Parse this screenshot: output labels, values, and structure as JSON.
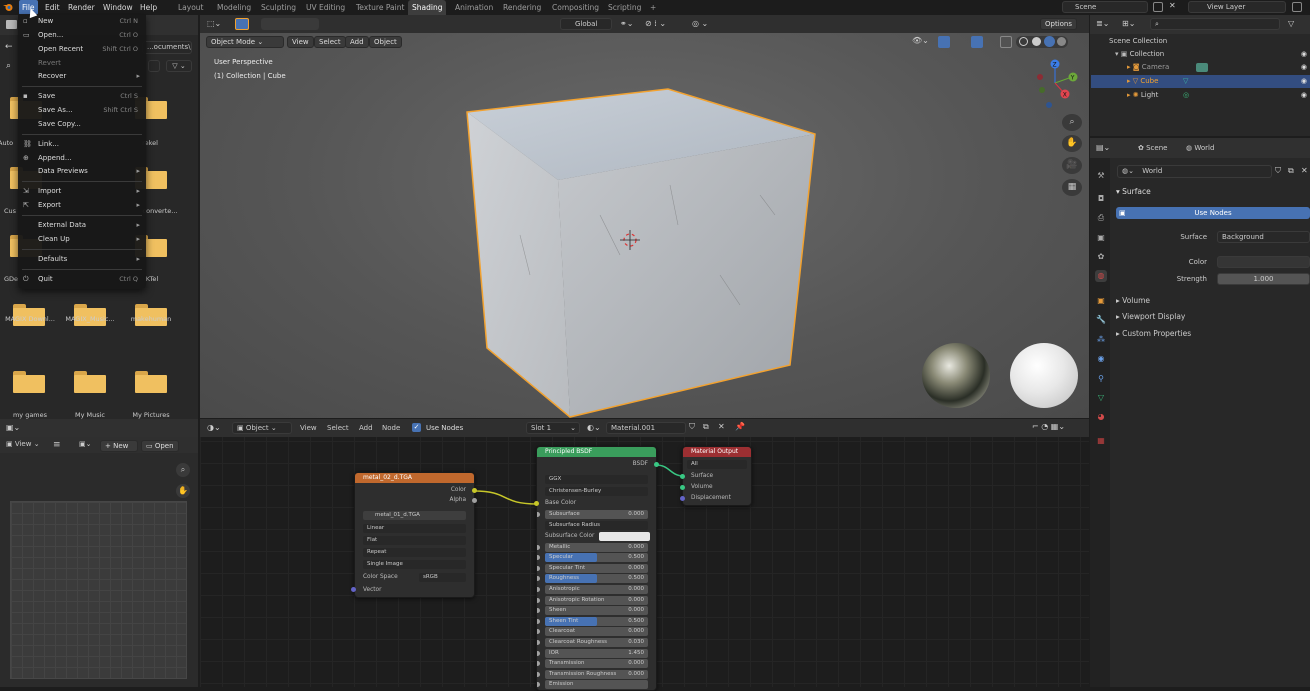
{
  "menubar": {
    "items": [
      "File",
      "Edit",
      "Render",
      "Window",
      "Help"
    ],
    "workspaces": [
      "Layout",
      "Modeling",
      "Sculpting",
      "UV Editing",
      "Texture Paint",
      "Shading",
      "Animation",
      "Rendering",
      "Compositing",
      "Scripting"
    ],
    "add_tab": "+",
    "scene": "Scene",
    "view_layer": "View Layer"
  },
  "file_menu": {
    "new": {
      "label": "New",
      "shortcut": "Ctrl N"
    },
    "open": {
      "label": "Open...",
      "shortcut": "Ctrl O"
    },
    "open_recent": {
      "label": "Open Recent",
      "shortcut": "Shift Ctrl O"
    },
    "revert": {
      "label": "Revert"
    },
    "recover": {
      "label": "Recover"
    },
    "save": {
      "label": "Save",
      "shortcut": "Ctrl S"
    },
    "save_as": {
      "label": "Save As...",
      "shortcut": "Shift Ctrl S"
    },
    "save_copy": {
      "label": "Save Copy..."
    },
    "link": {
      "label": "Link..."
    },
    "append": {
      "label": "Append..."
    },
    "data_previews": {
      "label": "Data Previews"
    },
    "import": {
      "label": "Import"
    },
    "export": {
      "label": "Export"
    },
    "external_data": {
      "label": "External Data"
    },
    "clean_up": {
      "label": "Clean Up"
    },
    "defaults": {
      "label": "Defaults"
    },
    "quit": {
      "label": "Quit",
      "shortcut": "Ctrl Q"
    }
  },
  "file_browser": {
    "path": "...ocuments\\",
    "partial_labels": [
      "Auto",
      "rekel",
      "Cus",
      "converte...",
      "GDe",
      "KTel"
    ],
    "folders": [
      "MAGIX Downl...",
      "MAGIX_Music...",
      "makehuman",
      "my games",
      "My Music",
      "My Pictures"
    ]
  },
  "viewport": {
    "mode": "Object Mode",
    "menus": [
      "View",
      "Select",
      "Add",
      "Object"
    ],
    "orientation": "Global",
    "options": "Options",
    "perspective": "User Perspective",
    "collection": "(1) Collection | Cube",
    "gizmo": {
      "z": "Z",
      "y": "Y",
      "x": "X"
    }
  },
  "image_editor": {
    "view": "View",
    "new": "New",
    "open": "Open"
  },
  "node_editor": {
    "object": "Object",
    "menus": [
      "View",
      "Select",
      "Add",
      "Node"
    ],
    "use_nodes": "Use Nodes",
    "slot": "Slot 1",
    "material": "Material.001",
    "image_node": {
      "title": "metal_02_d.TGA",
      "outputs": [
        "Color",
        "Alpha"
      ],
      "image_name": "metal_01_d.TGA",
      "interpolation": "Linear",
      "projection": "Flat",
      "extension": "Repeat",
      "source": "Single Image",
      "color_space_label": "Color Space",
      "color_space": "sRGB",
      "vector": "Vector"
    },
    "bsdf_node": {
      "title": "Principled BSDF",
      "output": "BSDF",
      "distribution": "GGX",
      "subsurface_method": "Christensen-Burley",
      "base_color": "Base Color",
      "subsurface_color": "Subsurface Color",
      "params": [
        {
          "name": "Subsurface",
          "value": "0.000",
          "fill": 0
        },
        {
          "name": "Subsurface Radius",
          "value": "",
          "fill": 0
        },
        {
          "name": "Metallic",
          "value": "0.000",
          "fill": 0
        },
        {
          "name": "Specular",
          "value": "0.500",
          "fill": 0.5
        },
        {
          "name": "Specular Tint",
          "value": "0.000",
          "fill": 0
        },
        {
          "name": "Roughness",
          "value": "0.500",
          "fill": 0.5
        },
        {
          "name": "Anisotropic",
          "value": "0.000",
          "fill": 0
        },
        {
          "name": "Anisotropic Rotation",
          "value": "0.000",
          "fill": 0
        },
        {
          "name": "Sheen",
          "value": "0.000",
          "fill": 0
        },
        {
          "name": "Sheen Tint",
          "value": "0.500",
          "fill": 0.5
        },
        {
          "name": "Clearcoat",
          "value": "0.000",
          "fill": 0
        },
        {
          "name": "Clearcoat Roughness",
          "value": "0.030",
          "fill": 0.03
        },
        {
          "name": "IOR",
          "value": "1.450",
          "fill": 0
        },
        {
          "name": "Transmission",
          "value": "0.000",
          "fill": 0
        },
        {
          "name": "Transmission Roughness",
          "value": "0.000",
          "fill": 0
        },
        {
          "name": "Emission",
          "value": "",
          "fill": 0
        }
      ]
    },
    "output_node": {
      "title": "Material Output",
      "target": "All",
      "inputs": [
        "Surface",
        "Volume",
        "Displacement"
      ]
    }
  },
  "outliner": {
    "scene_collection": "Scene Collection",
    "items": [
      {
        "label": "Collection"
      },
      {
        "label": "Camera"
      },
      {
        "label": "Cube"
      },
      {
        "label": "Light"
      }
    ]
  },
  "properties": {
    "tabs": [
      "Scene",
      "World"
    ],
    "world_name": "World",
    "surface_panel": "Surface",
    "use_nodes": "Use Nodes",
    "surface_label": "Surface",
    "surface_value": "Background",
    "color_label": "Color",
    "strength_label": "Strength",
    "strength_value": "1.000",
    "panels": [
      "Volume",
      "Viewport Display",
      "Custom Properties"
    ]
  },
  "colors": {
    "accent": "#4772b3",
    "selection_orange": "#f2a230",
    "image_node_header": "#c0682d",
    "bsdf_node_header": "#3a9d5c",
    "output_node_header": "#9c2f32"
  }
}
